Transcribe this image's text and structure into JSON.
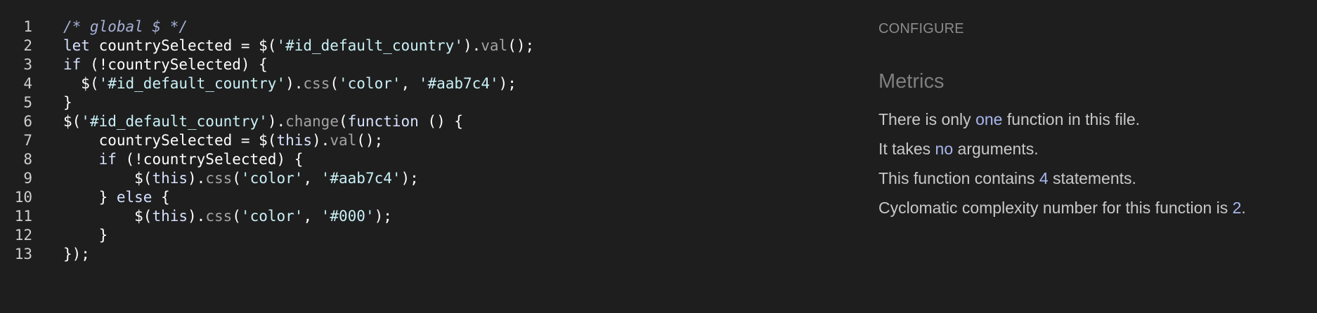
{
  "editor": {
    "lines": [
      {
        "num": "1",
        "indent": "",
        "tokens": [
          {
            "t": "/* global $ */",
            "c": "comment"
          }
        ]
      },
      {
        "num": "2",
        "indent": "",
        "tokens": [
          {
            "t": "let",
            "c": "keyword"
          },
          {
            "t": " countrySelected = $(",
            "c": "plain"
          },
          {
            "t": "'#id_default_country'",
            "c": "string"
          },
          {
            "t": ").",
            "c": "punct"
          },
          {
            "t": "val",
            "c": "method"
          },
          {
            "t": "();",
            "c": "punct"
          }
        ]
      },
      {
        "num": "3",
        "indent": "",
        "tokens": [
          {
            "t": "if",
            "c": "keyword"
          },
          {
            "t": " (!countrySelected) {",
            "c": "plain"
          }
        ]
      },
      {
        "num": "4",
        "indent": "  ",
        "tokens": [
          {
            "t": "$(",
            "c": "plain"
          },
          {
            "t": "'#id_default_country'",
            "c": "string"
          },
          {
            "t": ").",
            "c": "punct"
          },
          {
            "t": "css",
            "c": "method"
          },
          {
            "t": "(",
            "c": "punct"
          },
          {
            "t": "'color'",
            "c": "string"
          },
          {
            "t": ", ",
            "c": "punct"
          },
          {
            "t": "'#aab7c4'",
            "c": "string"
          },
          {
            "t": ");",
            "c": "punct"
          }
        ]
      },
      {
        "num": "5",
        "indent": "",
        "tokens": [
          {
            "t": "}",
            "c": "plain"
          }
        ]
      },
      {
        "num": "6",
        "indent": "",
        "tokens": [
          {
            "t": "$(",
            "c": "plain"
          },
          {
            "t": "'#id_default_country'",
            "c": "string"
          },
          {
            "t": ").",
            "c": "punct"
          },
          {
            "t": "change",
            "c": "method"
          },
          {
            "t": "(",
            "c": "punct"
          },
          {
            "t": "function",
            "c": "keyword"
          },
          {
            "t": " () {",
            "c": "plain"
          }
        ]
      },
      {
        "num": "7",
        "indent": "    ",
        "tokens": [
          {
            "t": "countrySelected = $(",
            "c": "plain"
          },
          {
            "t": "this",
            "c": "keyword"
          },
          {
            "t": ").",
            "c": "punct"
          },
          {
            "t": "val",
            "c": "method"
          },
          {
            "t": "();",
            "c": "punct"
          }
        ]
      },
      {
        "num": "8",
        "indent": "    ",
        "tokens": [
          {
            "t": "if",
            "c": "keyword"
          },
          {
            "t": " (!countrySelected) {",
            "c": "plain"
          }
        ]
      },
      {
        "num": "9",
        "indent": "        ",
        "tokens": [
          {
            "t": "$(",
            "c": "plain"
          },
          {
            "t": "this",
            "c": "keyword"
          },
          {
            "t": ").",
            "c": "punct"
          },
          {
            "t": "css",
            "c": "method"
          },
          {
            "t": "(",
            "c": "punct"
          },
          {
            "t": "'color'",
            "c": "string"
          },
          {
            "t": ", ",
            "c": "punct"
          },
          {
            "t": "'#aab7c4'",
            "c": "string"
          },
          {
            "t": ");",
            "c": "punct"
          }
        ]
      },
      {
        "num": "10",
        "indent": "    ",
        "tokens": [
          {
            "t": "} ",
            "c": "plain"
          },
          {
            "t": "else",
            "c": "keyword"
          },
          {
            "t": " {",
            "c": "plain"
          }
        ]
      },
      {
        "num": "11",
        "indent": "        ",
        "tokens": [
          {
            "t": "$(",
            "c": "plain"
          },
          {
            "t": "this",
            "c": "keyword"
          },
          {
            "t": ").",
            "c": "punct"
          },
          {
            "t": "css",
            "c": "method"
          },
          {
            "t": "(",
            "c": "punct"
          },
          {
            "t": "'color'",
            "c": "string"
          },
          {
            "t": ", ",
            "c": "punct"
          },
          {
            "t": "'#000'",
            "c": "string"
          },
          {
            "t": ");",
            "c": "punct"
          }
        ]
      },
      {
        "num": "12",
        "indent": "    ",
        "tokens": [
          {
            "t": "}",
            "c": "plain"
          }
        ]
      },
      {
        "num": "13",
        "indent": "",
        "tokens": [
          {
            "t": "});",
            "c": "plain"
          }
        ]
      }
    ]
  },
  "panel": {
    "configure_label": "CONFIGURE",
    "metrics_title": "Metrics",
    "metrics": [
      {
        "pre": "There is only ",
        "hl": "one",
        "post": " function in this file."
      },
      {
        "pre": "It takes ",
        "hl": "no",
        "post": " arguments."
      },
      {
        "pre": "This function contains ",
        "hl": "4",
        "post": " statements."
      },
      {
        "pre": "Cyclomatic complexity number for this function is ",
        "hl": "2",
        "post": "."
      }
    ]
  },
  "colors": {
    "background": "#1e1e1e",
    "highlight": "#a9b6ee",
    "comment": "#a6b0d6",
    "string": "#c9f0f7",
    "method": "#a3a3a3"
  }
}
